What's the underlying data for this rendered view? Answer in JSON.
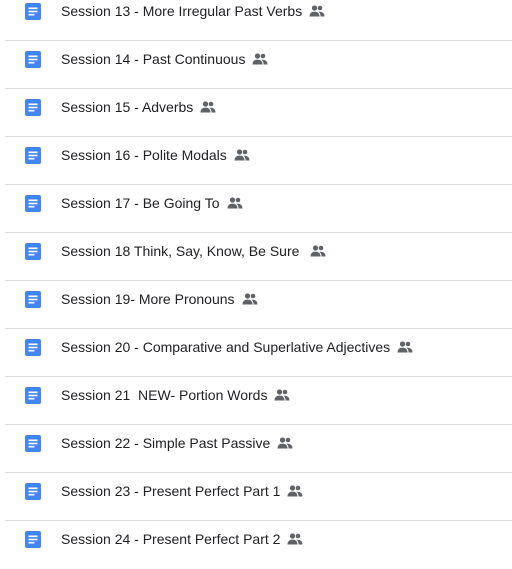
{
  "colors": {
    "doc_blue": "#4285f4",
    "text": "#202124",
    "icon_gray": "#5f6368",
    "divider": "#dadce0"
  },
  "files": [
    {
      "name": "Session 13 - More Irregular Past Verbs",
      "type_icon": "google-docs-icon",
      "status_icon": "shared-icon"
    },
    {
      "name": "Session 14 - Past Continuous",
      "type_icon": "google-docs-icon",
      "status_icon": "shared-icon"
    },
    {
      "name": "Session 15 - Adverbs",
      "type_icon": "google-docs-icon",
      "status_icon": "shared-icon"
    },
    {
      "name": "Session 16 - Polite Modals",
      "type_icon": "google-docs-icon",
      "status_icon": "shared-icon"
    },
    {
      "name": "Session 17 - Be Going To",
      "type_icon": "google-docs-icon",
      "status_icon": "shared-icon"
    },
    {
      "name": "Session 18 Think, Say, Know, Be Sure ",
      "type_icon": "google-docs-icon",
      "status_icon": "shared-icon"
    },
    {
      "name": "Session 19- More Pronouns",
      "type_icon": "google-docs-icon",
      "status_icon": "shared-icon"
    },
    {
      "name": "Session 20 - Comparative and Superlative Adjectives",
      "type_icon": "google-docs-icon",
      "status_icon": "shared-icon"
    },
    {
      "name": "Session 21  NEW- Portion Words",
      "type_icon": "google-docs-icon",
      "status_icon": "shared-icon"
    },
    {
      "name": "Session 22 - Simple Past Passive",
      "type_icon": "google-docs-icon",
      "status_icon": "shared-icon"
    },
    {
      "name": "Session 23 - Present Perfect Part 1",
      "type_icon": "google-docs-icon",
      "status_icon": "shared-icon"
    },
    {
      "name": "Session 24 - Present Perfect Part 2",
      "type_icon": "google-docs-icon",
      "status_icon": "shared-icon"
    }
  ]
}
